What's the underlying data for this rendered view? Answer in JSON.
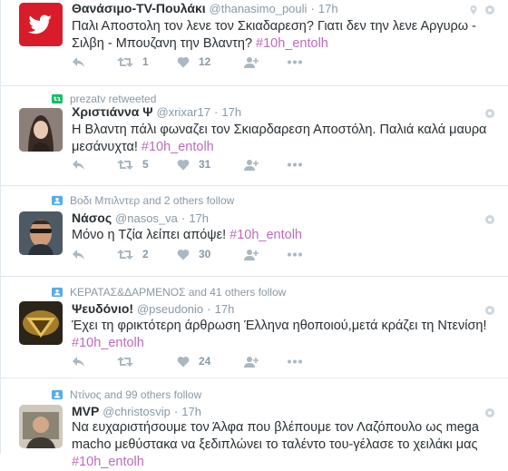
{
  "colors": {
    "hashtag": "#bd6bbb",
    "muted": "#8899a6",
    "text": "#292f33",
    "retweet_context": "#17bf63",
    "follow_context": "#55acee"
  },
  "tweets": [
    {
      "context": "",
      "fullname": "Θανάσιμο-TV-Πουλάκι",
      "username": "@thanasimo_pouli",
      "sep": "·",
      "time": "17h",
      "text": "Παλι Αποστολη τον λενε τον Σκιαδαρεση? Γιατι δεν την λενε Αργυρω - Σιλβη - Μπουζανη την Βλαντη?",
      "hashtag": "#10h_entolh",
      "retweets": "1",
      "likes": "12"
    },
    {
      "context": "prezatv retweeted",
      "fullname": "Χριστιάννα Ψ",
      "username": "@xrixar17",
      "sep": "·",
      "time": "17h",
      "text": "Η Βλαντη πάλι φωναζει τον Σκιαρδαρεση Αποστόλη. Παλιά καλά μαυρα μεσάνυχτα!",
      "hashtag": "#10h_entolh",
      "retweets": "5",
      "likes": "31"
    },
    {
      "context": "Βοδι Μπιλντερ and 2 others follow",
      "fullname": "Νάσος",
      "username": "@nasos_va",
      "sep": "·",
      "time": "17h",
      "text": "Μόνο η Τζία λείπει απόψε!",
      "hashtag": "#10h_entolh",
      "retweets": "2",
      "likes": "30"
    },
    {
      "context": "ΚΕΡΑΤΑΣ&ΔΑΡΜΕΝΟΣ and 41 others follow",
      "fullname": "Ψευδόνιο!",
      "username": "@pseudonio",
      "sep": "·",
      "time": "17h",
      "text": "Έχει τη φρικτότερη άρθρωση Έλληνα ηθοποιού,μετά κράζει τη Ντενίση!",
      "hashtag": "#10h_entolh",
      "retweets": "",
      "likes": "24"
    },
    {
      "context": "Ντίνος and 99 others follow",
      "fullname": "MVP",
      "username": "@christosvip",
      "sep": "·",
      "time": "17h",
      "text": "Να ευχαριστήσουμε τον Άλφα που βλέπουμε τον Λαζόπουλο ως mega macho μεθύστακα να ξεδιπλώνει το ταλέντο του-γέλασε το χειλάκι μας",
      "hashtag": "#10h_entolh",
      "retweets": "",
      "likes": ""
    }
  ]
}
